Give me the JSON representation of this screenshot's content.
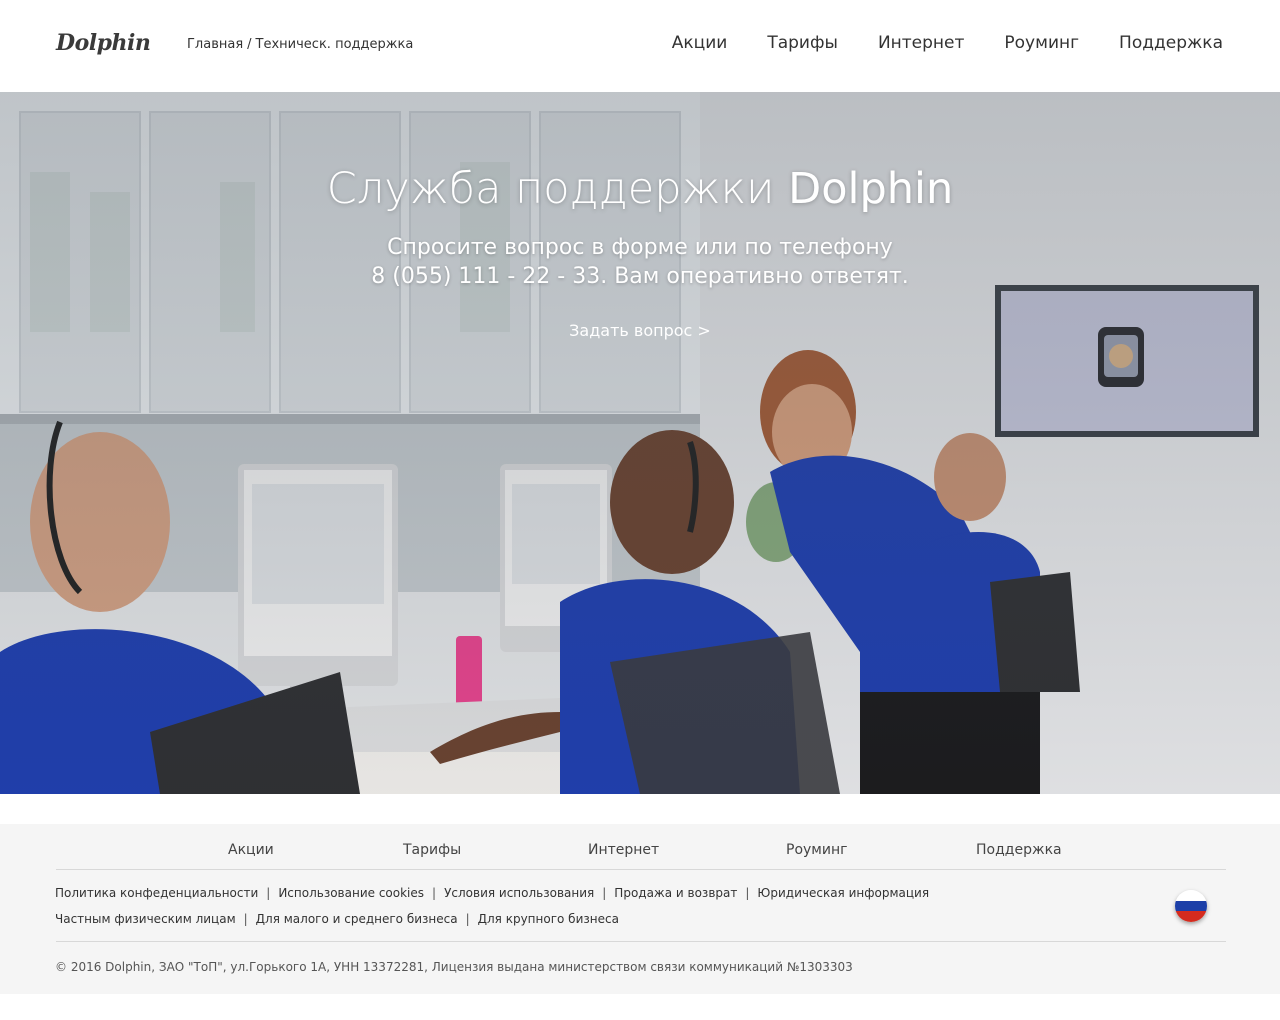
{
  "header": {
    "logo": "Dolphin",
    "breadcrumb": {
      "home": "Главная",
      "separator": "/",
      "current": "Техническ. поддержка"
    },
    "nav": [
      "Акции",
      "Тарифы",
      "Интернет",
      "Роуминг",
      "Поддержка"
    ]
  },
  "hero": {
    "title_prefix": "Служба поддержки",
    "title_brand": "Dolphin",
    "subtitle_line1": "Спросите вопрос в форме или по телефону",
    "subtitle_line2": "8 (055) 111 - 22 - 33. Вам оперативно ответят.",
    "cta": "Задать вопрос >",
    "image_icon": "support-team-photo"
  },
  "footer": {
    "nav": [
      "Акции",
      "Тарифы",
      "Интернет",
      "Роуминг",
      "Поддержка"
    ],
    "legal_row1": [
      "Политика конфеденциальности",
      "Использование cookies",
      "Условия использования",
      "Продажа и возврат",
      "Юридическая информация"
    ],
    "legal_row2": [
      "Частным физическим лицам",
      "Для малого и среднего бизнеса",
      "Для крупного бизнеса"
    ],
    "separator": "|",
    "language_icon": "russia-flag-icon",
    "copyright": "© 2016 Dolphin, ЗАО \"ТоП\", ул.Горького 1А, УНН 13372281, Лицензия выдана министерством связи коммуникаций №1303303"
  },
  "colors": {
    "shirt_blue": "#1f3fb0",
    "footer_bg": "#f5f5f5",
    "flag_white": "#ffffff",
    "flag_blue": "#1c3fa8",
    "flag_red": "#d52b1e"
  }
}
